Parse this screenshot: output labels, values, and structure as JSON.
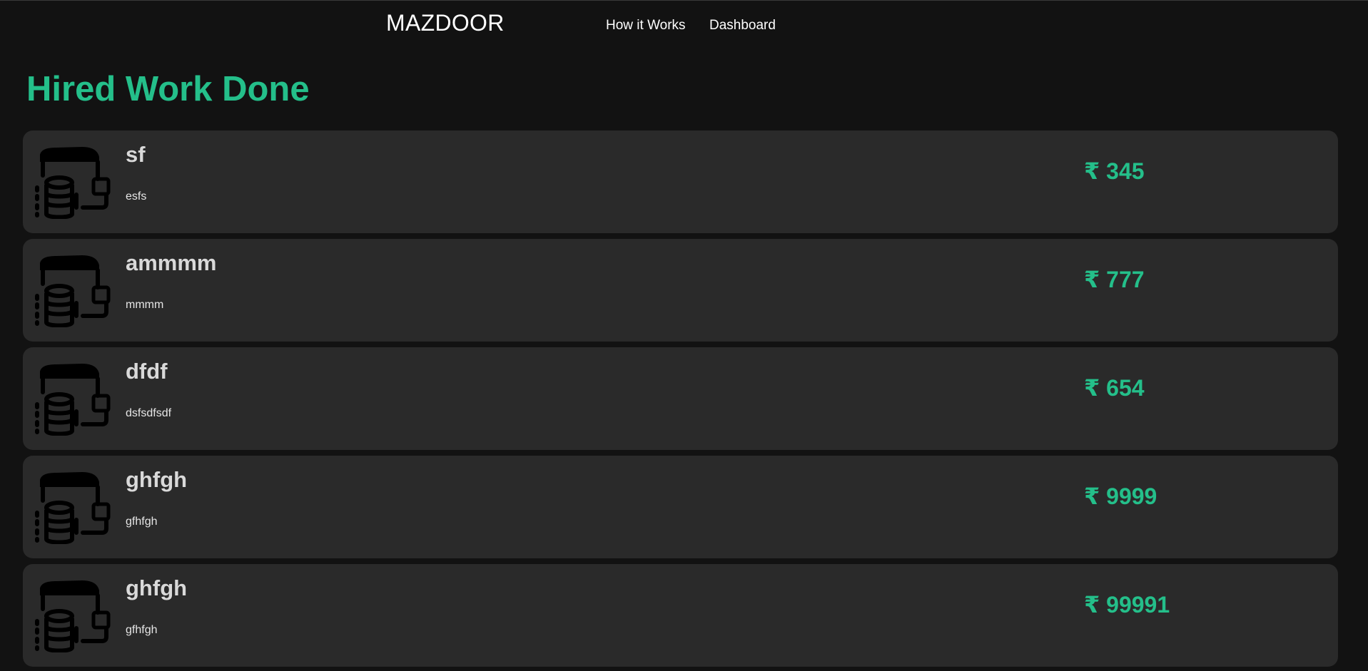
{
  "navbar": {
    "brand": "MAZDOOR",
    "links": [
      {
        "label": "How it Works"
      },
      {
        "label": "Dashboard"
      }
    ]
  },
  "page": {
    "title": "Hired Work Done"
  },
  "currency_symbol": "₹",
  "icon": "worker-tools-icon",
  "colors": {
    "background": "#121212",
    "card": "#2a2a2a",
    "accent": "#24bf8a",
    "text": "#ffffff",
    "card_title": "#d9d9d9"
  },
  "works": [
    {
      "name": "sf",
      "description": "esfs",
      "price": "₹ 345"
    },
    {
      "name": "ammmm",
      "description": "mmmm",
      "price": "₹ 777"
    },
    {
      "name": "dfdf",
      "description": "dsfsdfsdf",
      "price": "₹ 654"
    },
    {
      "name": "ghfgh",
      "description": "gfhfgh",
      "price": "₹ 9999"
    },
    {
      "name": "ghfgh",
      "description": "gfhfgh",
      "price": "₹ 99991"
    }
  ]
}
